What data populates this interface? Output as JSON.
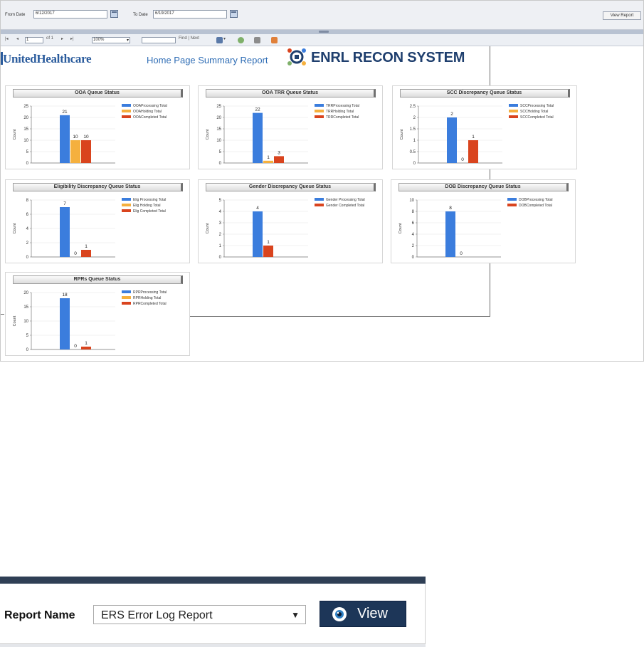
{
  "params": {
    "from_label": "From Date",
    "from_value": "6/12/2017",
    "to_label": "To Date",
    "to_value": "6/19/2017",
    "view_report": "View Report"
  },
  "toolbar": {
    "page_value": "1",
    "page_of": "of 1",
    "zoom": "100%",
    "find_next": "Find | Next"
  },
  "header": {
    "brand": "UnitedHealthcare",
    "report_title": "Home Page Summary Report",
    "system_title": "ENRL RECON SYSTEM"
  },
  "colors": {
    "processing": "#3b7ddd",
    "holding": "#f5b03e",
    "completed": "#d9441e"
  },
  "chart_data": [
    {
      "type": "bar",
      "title": "OOA Queue Status",
      "ylabel": "Count",
      "ylim": [
        0,
        25
      ],
      "ticks": [
        0,
        5,
        10,
        15,
        20,
        25
      ],
      "series": [
        {
          "name": "OOAProcessing Total",
          "values": [
            21
          ]
        },
        {
          "name": "OOAHolding Total",
          "values": [
            10
          ]
        },
        {
          "name": "OOACompleted Total",
          "values": [
            10
          ]
        }
      ]
    },
    {
      "type": "bar",
      "title": "OOA TRR Queue Status",
      "ylabel": "Count",
      "ylim": [
        0,
        25
      ],
      "ticks": [
        0,
        5,
        10,
        15,
        20,
        25
      ],
      "series": [
        {
          "name": "TRRProcessing Total",
          "values": [
            22
          ]
        },
        {
          "name": "TRRHolding Total",
          "values": [
            1
          ]
        },
        {
          "name": "TRRCompleted Total",
          "values": [
            3
          ]
        }
      ]
    },
    {
      "type": "bar",
      "title": "SCC Discrepancy Queue Status",
      "ylabel": "Count",
      "ylim": [
        0,
        2.5
      ],
      "ticks": [
        0,
        0.5,
        1,
        1.5,
        2,
        2.5
      ],
      "series": [
        {
          "name": "SCCProcessing Total",
          "values": [
            2
          ]
        },
        {
          "name": "SCCHolding Total",
          "values": [
            0
          ]
        },
        {
          "name": "SCCCompleted Total",
          "values": [
            1
          ]
        }
      ]
    },
    {
      "type": "bar",
      "title": "Eligibility Discrepancy Queue Status",
      "ylabel": "Count",
      "ylim": [
        0,
        8
      ],
      "ticks": [
        0,
        2,
        4,
        6,
        8
      ],
      "series": [
        {
          "name": "Elig Processing Total",
          "values": [
            7
          ]
        },
        {
          "name": "Elig Holding Total",
          "values": [
            0
          ]
        },
        {
          "name": "Elig Completed Total",
          "values": [
            1
          ]
        }
      ]
    },
    {
      "type": "bar",
      "title": "Gender Discrepancy Queue Status",
      "ylabel": "Count",
      "ylim": [
        0,
        5
      ],
      "ticks": [
        0,
        1,
        2,
        3,
        4,
        5
      ],
      "series": [
        {
          "name": "Gender Processing Total",
          "values": [
            4
          ]
        },
        {
          "name": "Gender Completed Total",
          "values": [
            1
          ]
        }
      ]
    },
    {
      "type": "bar",
      "title": "DOB Discrepancy Queue Status",
      "ylabel": "Count",
      "ylim": [
        0,
        10
      ],
      "ticks": [
        0,
        2,
        4,
        6,
        8,
        10
      ],
      "series": [
        {
          "name": "DOBProcessing Total",
          "values": [
            8
          ]
        },
        {
          "name": "DOBCompleted Total",
          "values": [
            0
          ]
        }
      ]
    },
    {
      "type": "bar",
      "title": "RPRs Queue Status",
      "ylabel": "Count",
      "ylim": [
        0,
        20
      ],
      "ticks": [
        0,
        5,
        10,
        15,
        20
      ],
      "series": [
        {
          "name": "RPRProcessing Total",
          "values": [
            18
          ]
        },
        {
          "name": "RPRHolding Total",
          "values": [
            0
          ]
        },
        {
          "name": "RPRCompleted Total",
          "values": [
            1
          ]
        }
      ]
    }
  ],
  "report_picker": {
    "label": "Report Name",
    "selected": "ERS Error Log Report",
    "arrow": "▼",
    "view_label": "View"
  }
}
